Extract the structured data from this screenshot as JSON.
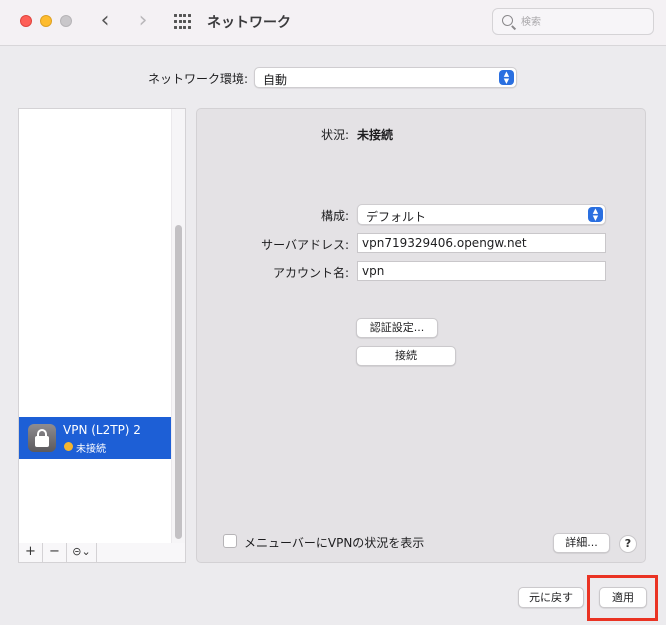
{
  "toolbar": {
    "title": "ネットワーク",
    "search_placeholder": "検索",
    "back_label": "‹",
    "forward_label": "›",
    "icons": [
      "close",
      "minimize",
      "zoom-disabled",
      "back-chevron-icon",
      "forward-chevron-icon",
      "grid-icon",
      "search-icon"
    ]
  },
  "location": {
    "label": "ネットワーク環境:",
    "value": "自動"
  },
  "sidebar": {
    "services": [
      {
        "name": "VPN (L2TP) 2",
        "status": "未接続",
        "status_color": "#f4b52f",
        "icon": "lock-icon"
      }
    ],
    "bar": {
      "add": "+",
      "remove": "−",
      "action": "⊝⌄"
    }
  },
  "panel": {
    "status_label": "状況:",
    "status_value": "未接続",
    "config_label": "構成:",
    "config_value": "デフォルト",
    "server_label": "サーバアドレス:",
    "server_value": "vpn719329406.opengw.net",
    "account_label": "アカウント名:",
    "account_value": "vpn",
    "auth_button": "認証設定...",
    "connect_button": "接続",
    "show_vpn_status_label": "メニューバーにVPNの状況を表示",
    "show_vpn_status_checked": false,
    "advanced_button": "詳細...",
    "help_label": "?"
  },
  "footer": {
    "revert_button": "元に戻す",
    "apply_button": "適用"
  },
  "colors": {
    "accent": "#1d5fd6",
    "highlight": "#ea3323"
  }
}
